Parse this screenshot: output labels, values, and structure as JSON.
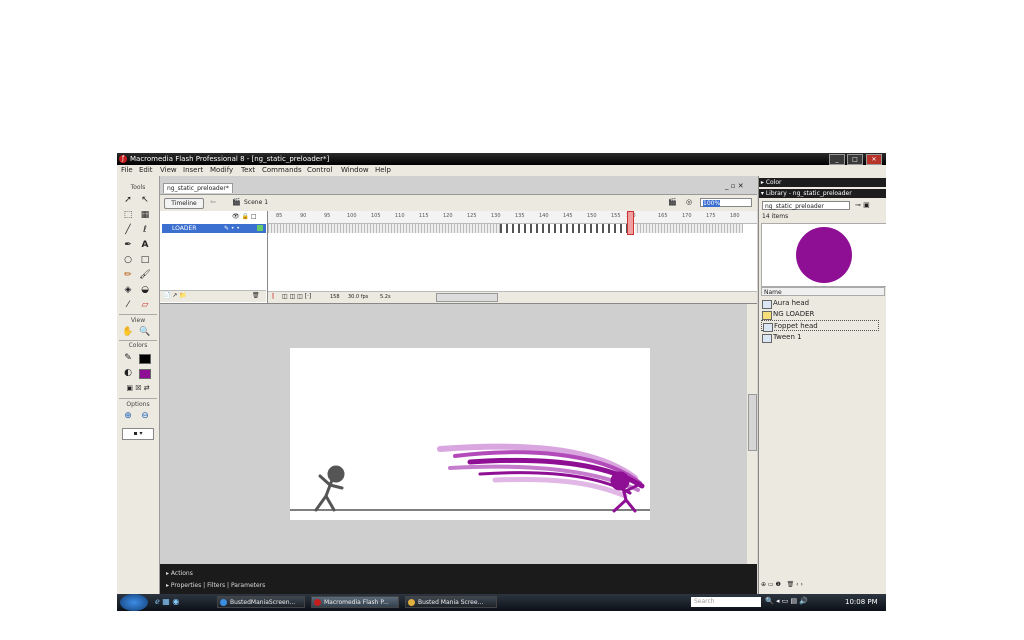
{
  "window": {
    "title": "Macromedia Flash Professional 8 - [ng_static_preloader*]",
    "buttons": [
      "_",
      "□",
      "✕"
    ]
  },
  "menu": [
    "File",
    "Edit",
    "View",
    "Insert",
    "Modify",
    "Text",
    "Commands",
    "Control",
    "Window",
    "Help"
  ],
  "tools": {
    "header": "Tools",
    "view_header": "View",
    "colors_header": "Colors",
    "options_header": "Options"
  },
  "document": {
    "tab": "ng_static_preloader*",
    "timeline_button": "Timeline",
    "scene": "Scene 1",
    "zoom": "100%",
    "layer_name": "LOADER",
    "ruler_ticks": [
      "85",
      "90",
      "95",
      "100",
      "105",
      "110",
      "115",
      "120",
      "125",
      "130",
      "135",
      "140",
      "145",
      "150",
      "155",
      "160",
      "165",
      "170",
      "175",
      "180"
    ],
    "frame_number": "158",
    "frame_rate": "30.0 fps",
    "elapsed": "5.2s"
  },
  "bottom_panels": {
    "actions": "Actions",
    "properties": "Properties",
    "filters": "Filters",
    "parameters": "Parameters"
  },
  "right_panel": {
    "color_title": "Color",
    "library_title": "Library - ng_static_preloader",
    "library_select": "ng_static_preloader",
    "items_count": "14 items",
    "name_header": "Name",
    "items": [
      "Aura head",
      "NG LOADER",
      "Foppet head",
      "Tween 1"
    ]
  },
  "taskbar": {
    "buttons": [
      "BustedManiaScreen...",
      "Macromedia Flash P...",
      "Busted Mania Scree..."
    ],
    "search_placeholder": "Search",
    "clock": "10:08 PM"
  },
  "colors": {
    "accent_purple": "#8e0f94",
    "playhead": "#e06060"
  }
}
